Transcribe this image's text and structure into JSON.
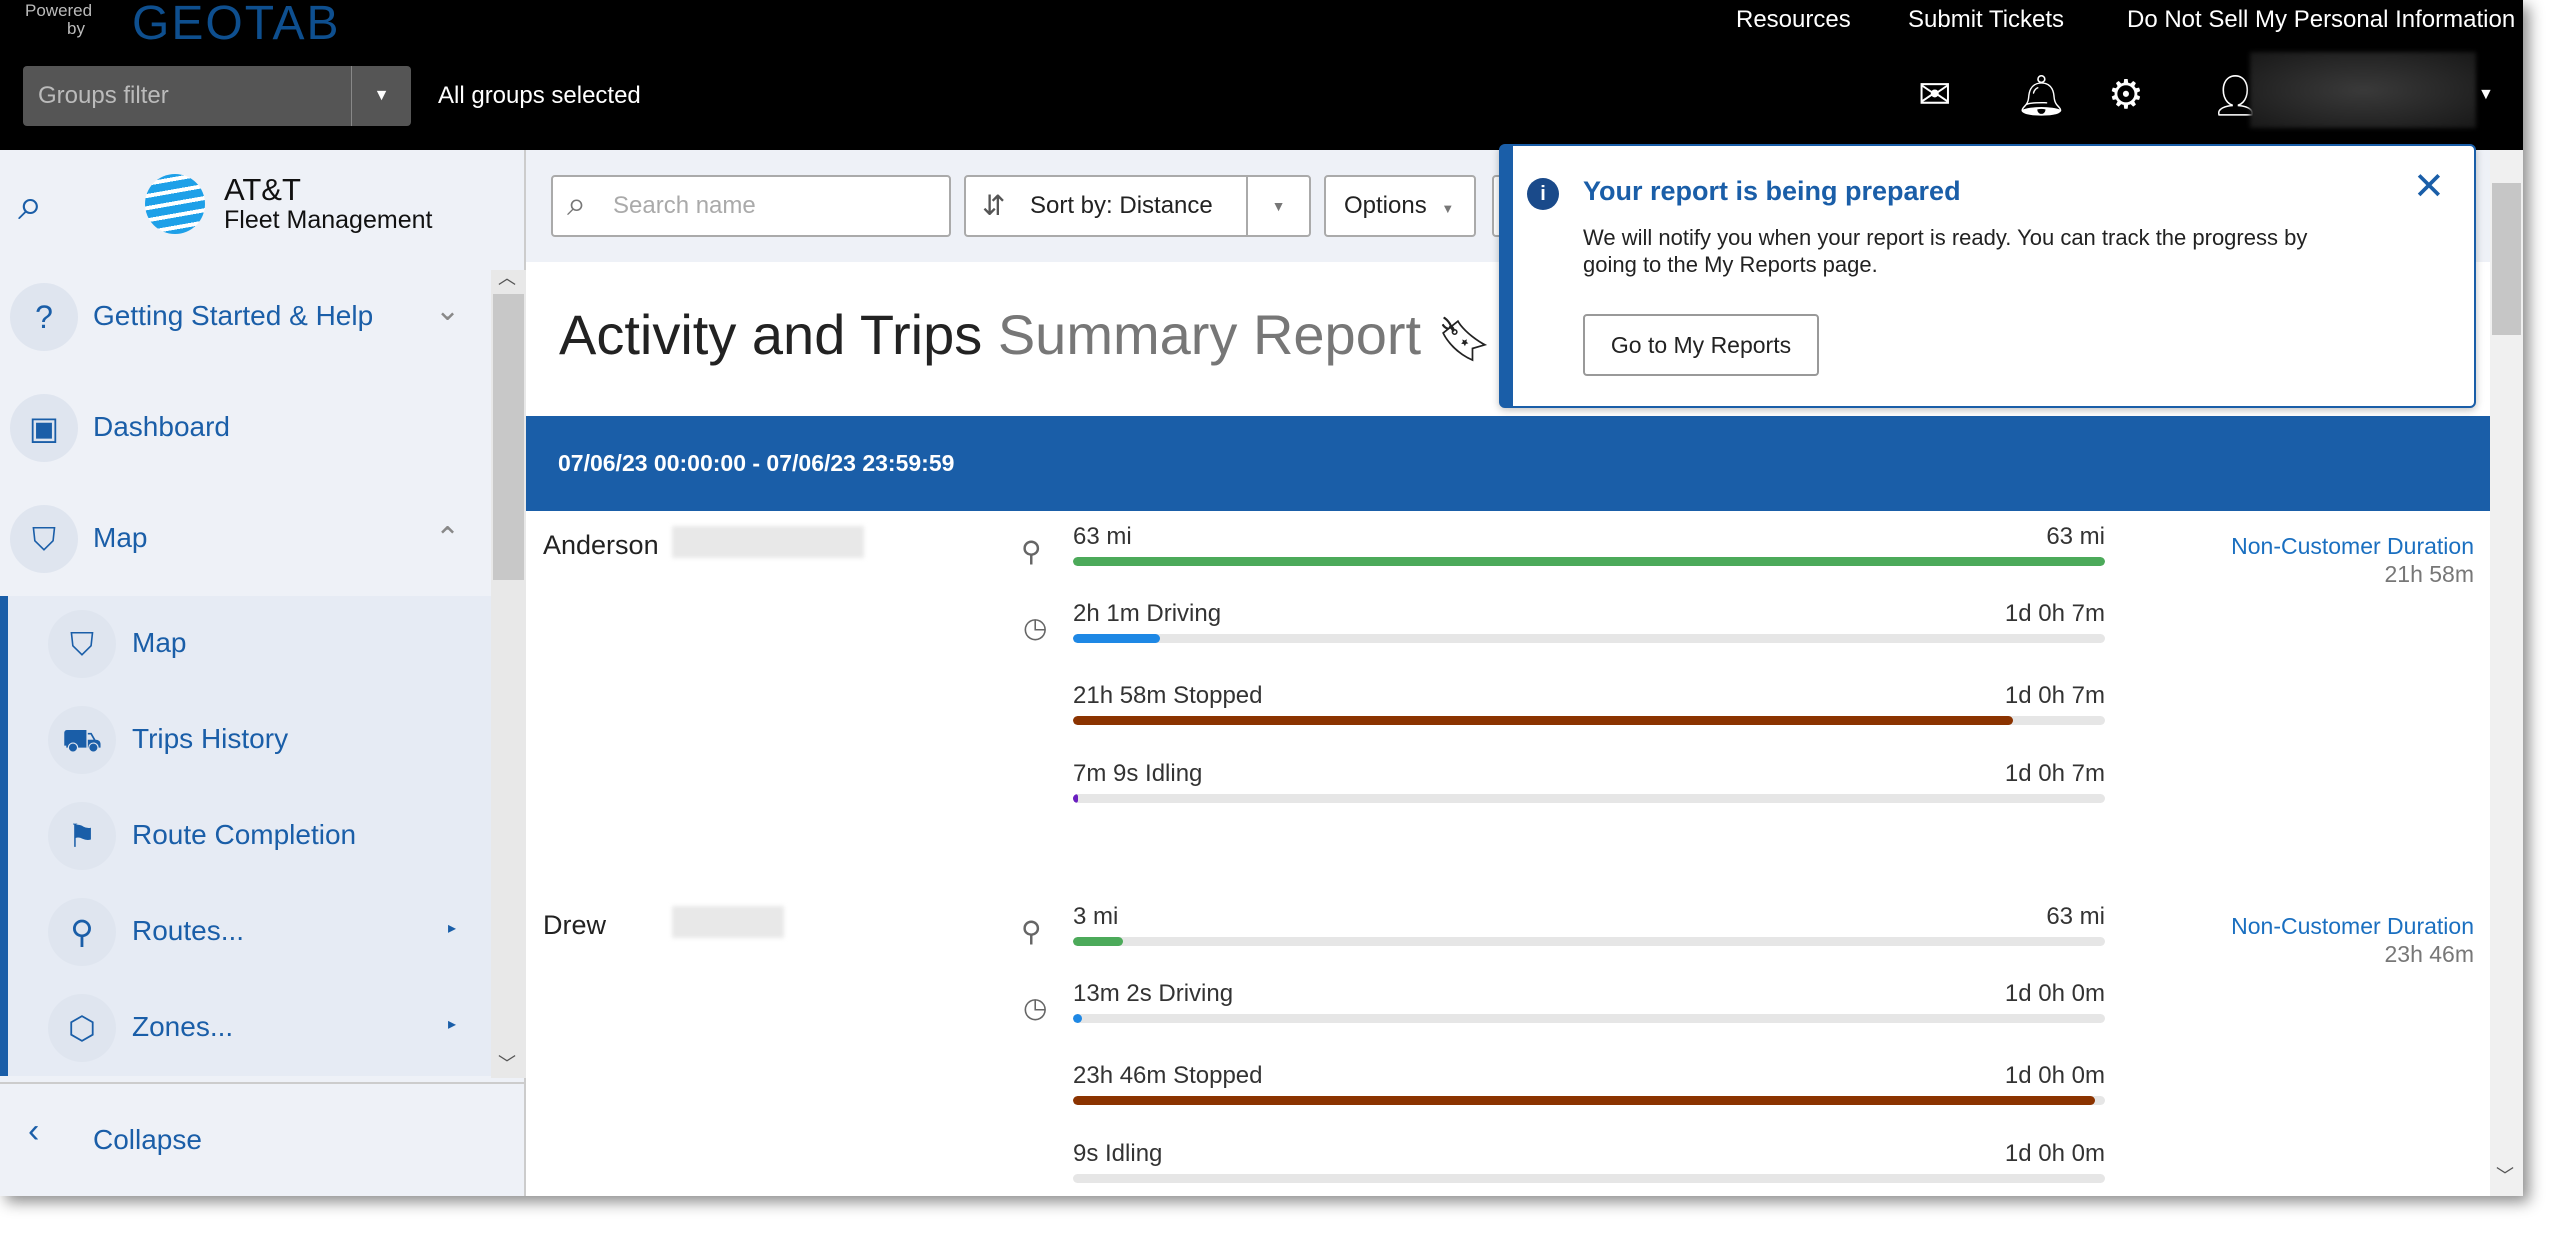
{
  "header": {
    "powered_by": "Powered by",
    "brand": "GEOTAB",
    "links": [
      "Resources",
      "Submit Tickets",
      "Do Not Sell My Personal Information"
    ],
    "groups_filter_placeholder": "Groups filter",
    "groups_status": "All groups selected"
  },
  "sidebar": {
    "logo_line1": "AT&T",
    "logo_line2": "Fleet Management",
    "items": [
      {
        "label": "Getting Started & Help",
        "icon": "help-icon"
      },
      {
        "label": "Dashboard",
        "icon": "dashboard-icon"
      },
      {
        "label": "Map",
        "icon": "map-icon"
      }
    ],
    "subitems": [
      {
        "label": "Map",
        "icon": "map-icon"
      },
      {
        "label": "Trips History",
        "icon": "trips-icon"
      },
      {
        "label": "Route Completion",
        "icon": "route-completion-icon"
      },
      {
        "label": "Routes...",
        "icon": "routes-icon"
      },
      {
        "label": "Zones...",
        "icon": "zones-icon"
      }
    ],
    "collapse": "Collapse"
  },
  "toolbar": {
    "search_placeholder": "Search name",
    "sort_label": "Sort by:",
    "sort_value": "Distance",
    "options": "Options"
  },
  "report": {
    "title_main": "Activity and Trips",
    "title_sub": "Summary Report",
    "date_range": "07/06/23 00:00:00 - 07/06/23 23:59:59"
  },
  "drivers": [
    {
      "name": "Anderson",
      "metrics": [
        {
          "label": "63 mi",
          "max": "63 mi",
          "fraction": 1.0,
          "color": "#4caa5a"
        },
        {
          "label": "2h 1m Driving",
          "max": "1d 0h 7m",
          "fraction": 0.084,
          "color": "#1e88e5"
        },
        {
          "label": "21h 58m Stopped",
          "max": "1d 0h 7m",
          "fraction": 0.911,
          "color": "#8b3300"
        },
        {
          "label": "7m 9s Idling",
          "max": "1d 0h 7m",
          "fraction": 0.005,
          "color": "#6a1fc0"
        }
      ],
      "ncd_label": "Non-Customer Duration",
      "ncd_value": "21h 58m"
    },
    {
      "name": "Drew",
      "metrics": [
        {
          "label": "3 mi",
          "max": "63 mi",
          "fraction": 0.048,
          "color": "#4caa5a"
        },
        {
          "label": "13m 2s Driving",
          "max": "1d 0h 0m",
          "fraction": 0.009,
          "color": "#1e88e5"
        },
        {
          "label": "23h 46m Stopped",
          "max": "1d 0h 0m",
          "fraction": 0.99,
          "color": "#8b3300"
        },
        {
          "label": "9s Idling",
          "max": "1d 0h 0m",
          "fraction": 0.0,
          "color": "#6a1fc0"
        }
      ],
      "ncd_label": "Non-Customer Duration",
      "ncd_value": "23h 46m"
    }
  ],
  "toast": {
    "title": "Your report is being prepared",
    "message": "We will notify you when your report is ready. You can track the progress by going to the My Reports page.",
    "button": "Go to My Reports"
  }
}
